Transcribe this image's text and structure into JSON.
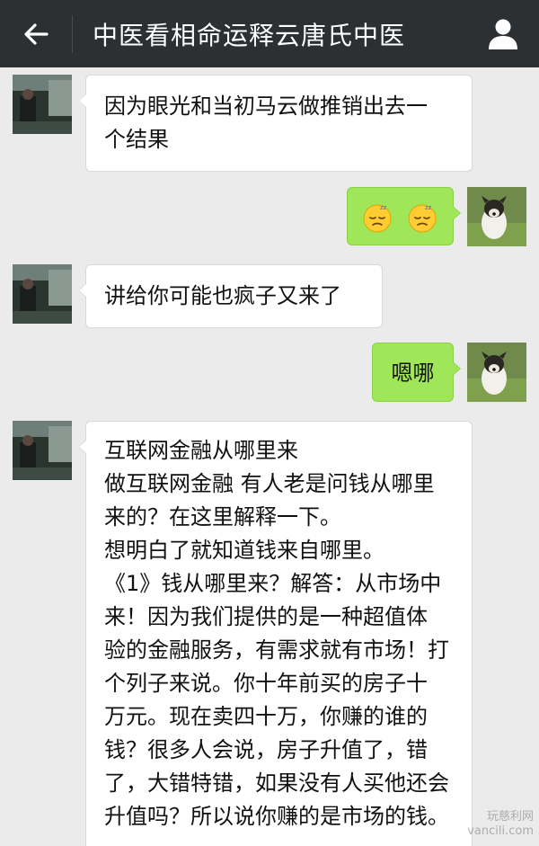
{
  "header": {
    "title": "中医看相命运释云唐氏中医",
    "back_icon": "back-arrow-icon",
    "profile_icon": "user-profile-icon"
  },
  "messages": [
    {
      "side": "left",
      "lines": [
        "因为眼光和当初马云做推销出去一",
        "个结果"
      ]
    },
    {
      "side": "right",
      "emoji": [
        "sleepy-face-emoji",
        "sleepy-face-emoji"
      ]
    },
    {
      "side": "left",
      "lines": [
        "讲给你可能也疯子又来了"
      ]
    },
    {
      "side": "right",
      "lines": [
        "嗯哪"
      ]
    },
    {
      "side": "left",
      "lines": [
        "互联网金融从哪里来",
        "做互联网金融  有人老是问钱从哪里",
        "来的？在这里解释一下。",
        "想明白了就知道钱来自哪里。",
        "《1》钱从哪里来？解答：从市场中",
        "来！因为我们提供的是一种超值体",
        "验的金融服务，有需求就有市场！打",
        "个列子来说。你十年前买的房子十",
        "万元。现在卖四十万，你赚的谁的",
        "钱？很多人会说，房子升值了，错",
        "了，大错特错，如果没有人买他还会",
        "升值吗？所以说你赚的是市场的钱。"
      ]
    }
  ],
  "watermark": [
    "玩慈利网",
    "vancili.com"
  ],
  "colors": {
    "header_bg": "#2d3033",
    "chat_bg": "#ebebeb",
    "sent_bubble": "#9fe658",
    "received_bubble": "#ffffff"
  }
}
